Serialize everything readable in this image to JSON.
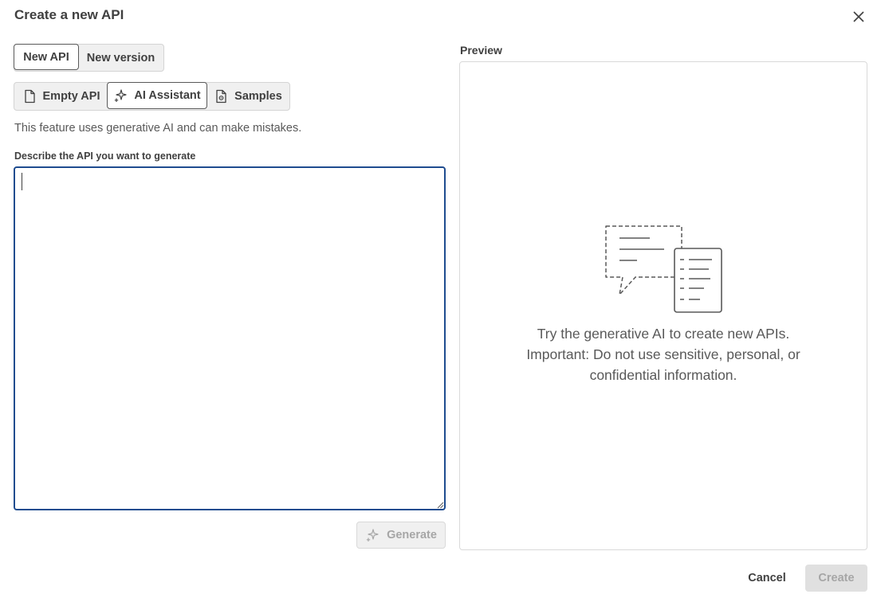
{
  "dialog": {
    "title": "Create a new API",
    "close_icon": "close-icon"
  },
  "mode_tabs": [
    {
      "label": "New API",
      "selected": true
    },
    {
      "label": "New version",
      "selected": false
    }
  ],
  "type_tabs": [
    {
      "label": "Empty API",
      "icon": "document-icon",
      "selected": false
    },
    {
      "label": "AI Assistant",
      "icon": "sparkle-icon",
      "selected": true
    },
    {
      "label": "Samples",
      "icon": "sample-document-icon",
      "selected": false
    }
  ],
  "disclaimer": "This feature uses generative AI and can make mistakes.",
  "prompt": {
    "label": "Describe the API you want to generate",
    "value": "",
    "placeholder": ""
  },
  "generate_button": {
    "label": "Generate",
    "icon": "sparkle-icon",
    "enabled": false
  },
  "preview": {
    "label": "Preview",
    "illustration_icon": "chat-document-illustration-icon",
    "message_lines": [
      "Try the generative AI to create new APIs.",
      "Important: Do not use sensitive, personal, or",
      "confidential information."
    ]
  },
  "footer": {
    "cancel_label": "Cancel",
    "create_label": "Create",
    "create_enabled": false
  },
  "colors": {
    "focus_border": "#1f4c8f",
    "text": "#404040",
    "disabled_text": "#a6a6a6"
  }
}
